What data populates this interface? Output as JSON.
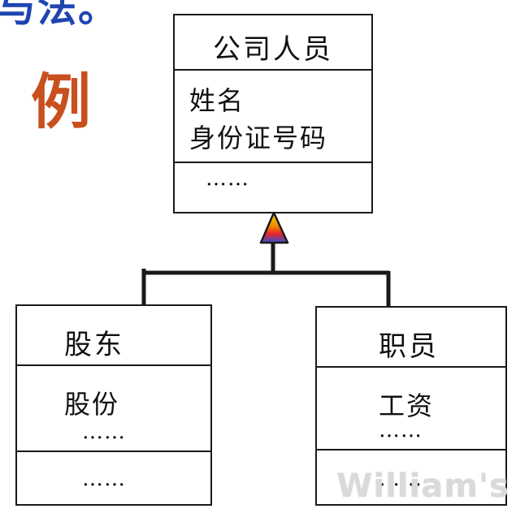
{
  "corner_text": "与法。",
  "example_char": "例",
  "classes": {
    "parent": {
      "name": "公司人员",
      "attributes": [
        "姓名",
        "身份证号码"
      ],
      "methods_placeholder": "……"
    },
    "child_left": {
      "name": "股东",
      "attributes": [
        "股份"
      ],
      "attributes_more": "……",
      "methods_placeholder": "……"
    },
    "child_right": {
      "name": "职员",
      "attributes": [
        "工资"
      ],
      "attributes_more": "……",
      "methods_placeholder": "……"
    }
  },
  "relationship": "generalization",
  "watermark": "William's",
  "colors": {
    "corner_text": "#1f45b0",
    "example_char": "#c8501e",
    "arrowhead_fill": [
      "#f5d400",
      "#e8252a",
      "#3050d8"
    ],
    "line": "#1a1a1a"
  }
}
